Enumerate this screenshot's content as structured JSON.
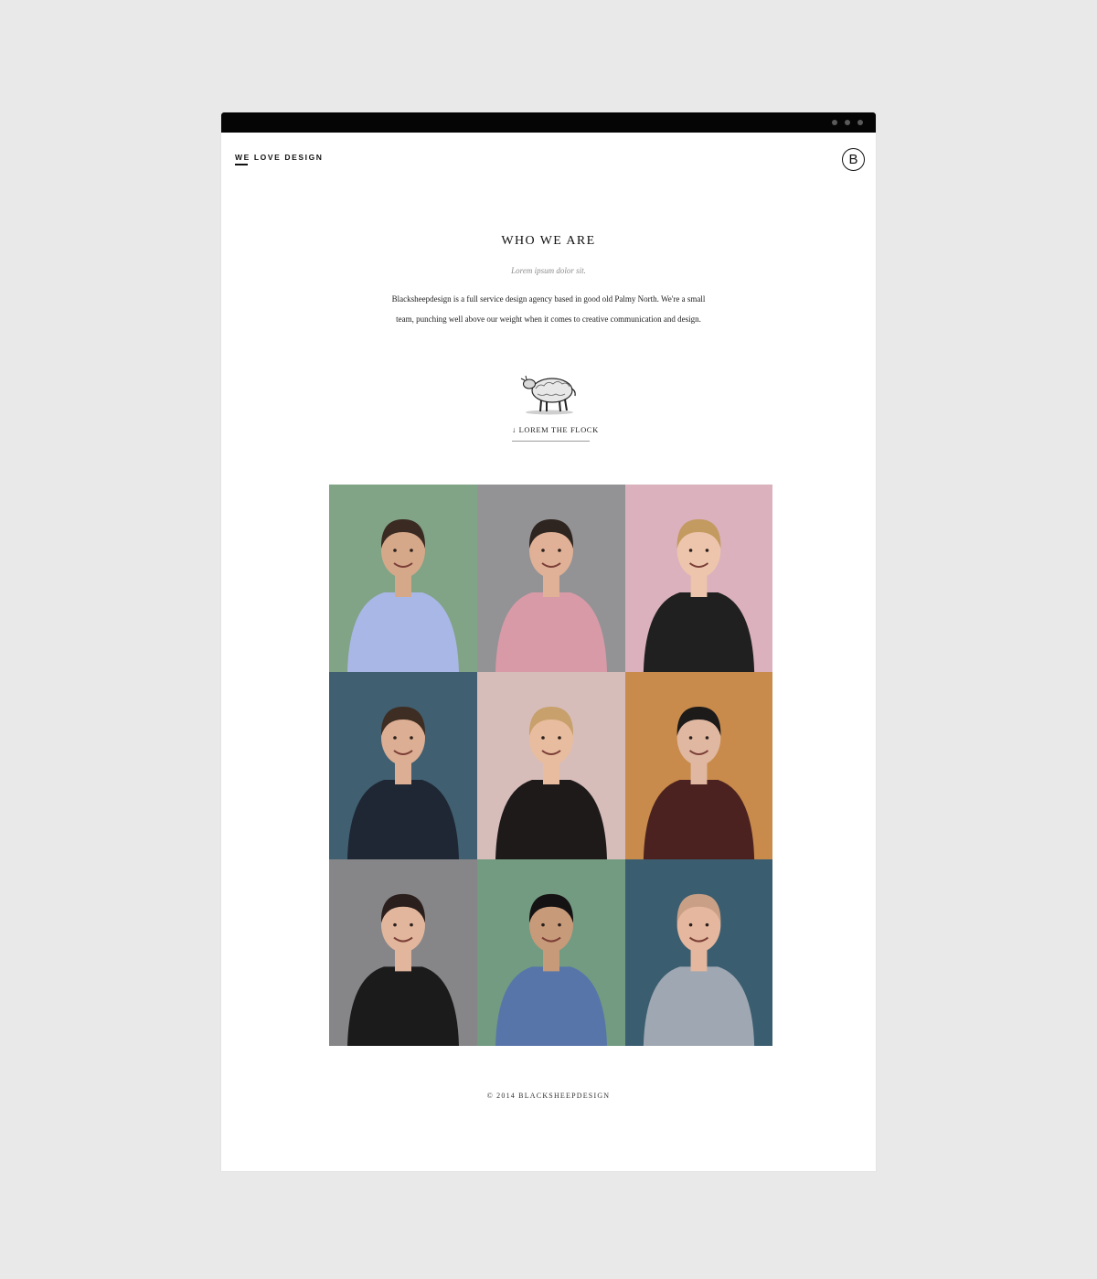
{
  "header": {
    "brand": "WE LOVE DESIGN",
    "logo_letter": "B"
  },
  "hero": {
    "heading": "WHO WE ARE",
    "subheading": "Lorem ipsum dolor sit.",
    "intro": "Blacksheepdesign is a full service design agency based in good old Palmy North. We're a small team, punching well above our weight when it comes to creative communication and design.",
    "link_label": "↓ LOREM THE FLOCK"
  },
  "team": [
    {
      "bg": "#8aae8f",
      "skin": "#d6a88a",
      "hair": "#3a2a22",
      "top": "#a9b7e6"
    },
    {
      "bg": "#9d9d9f",
      "skin": "#e0b196",
      "hair": "#2e2520",
      "top": "#d99aa7"
    },
    {
      "bg": "#e8bdc8",
      "skin": "#edc5ad",
      "hair": "#c39a5f",
      "top": "#202020"
    },
    {
      "bg": "#446579",
      "skin": "#dcae93",
      "hair": "#3e2d22",
      "top": "#1e2733"
    },
    {
      "bg": "#e5c9c6",
      "skin": "#e8bc9e",
      "hair": "#c7a06b",
      "top": "#1e1a1a"
    },
    {
      "bg": "#d59450",
      "skin": "#e0b7a1",
      "hair": "#1d1a1a",
      "top": "#4b2220"
    },
    {
      "bg": "#8f8f92",
      "skin": "#e2b69d",
      "hair": "#2a1f1c",
      "top": "#1b1b1c"
    },
    {
      "bg": "#7aa58b",
      "skin": "#c79a7a",
      "hair": "#141212",
      "top": "#5875a9"
    },
    {
      "bg": "#3f6378",
      "skin": "#e4b79e",
      "hair": "#c9a085",
      "top": "#9fa8b2"
    }
  ],
  "footer": {
    "copyright": "© 2014 BLACKSHEEPDESIGN"
  }
}
